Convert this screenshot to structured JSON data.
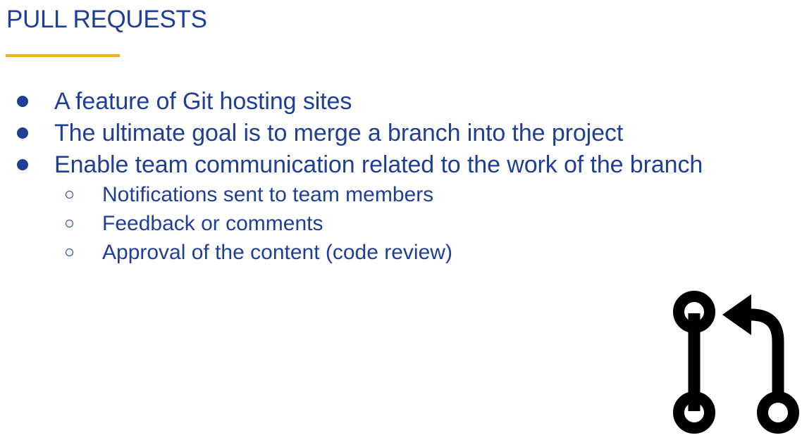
{
  "slide": {
    "title": "PULL REQUESTS",
    "accent_color": "#f2b01e",
    "text_color": "#1f3f95",
    "bullets": [
      "A feature of Git hosting sites",
      "The ultimate goal is to merge a branch into the project",
      "Enable team communication related to the work of the branch"
    ],
    "sub_bullets": [
      "Notifications sent to team members",
      "Feedback or comments",
      "Approval of the content (code review)"
    ],
    "icon": "git-pull-request-icon"
  }
}
